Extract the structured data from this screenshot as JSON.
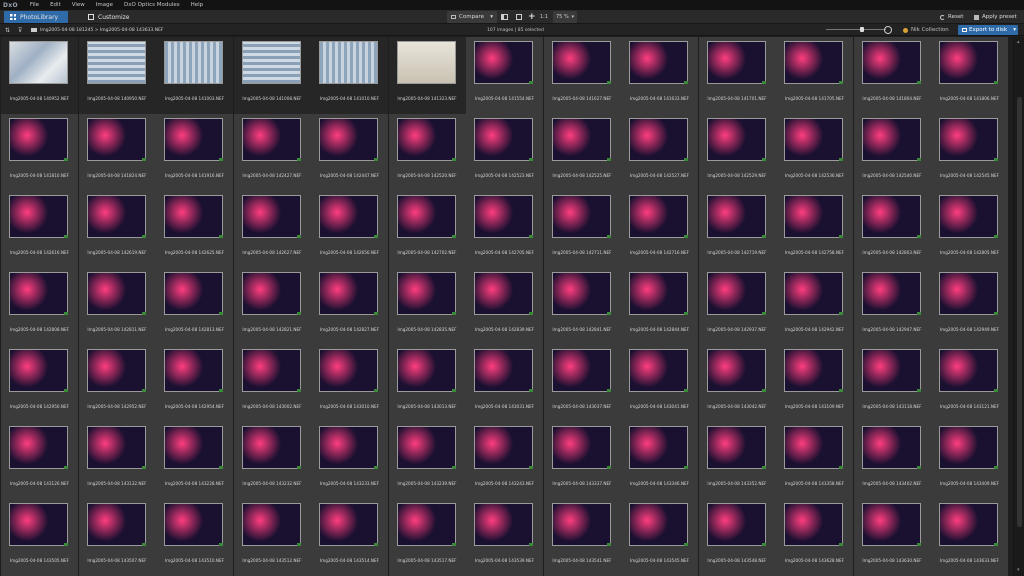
{
  "app": {
    "logo": "DxO"
  },
  "menu": [
    "File",
    "Edit",
    "View",
    "Image",
    "DxO Optics Modules",
    "Help"
  ],
  "tabs": {
    "photolibrary": "PhotoLibrary",
    "customize": "Customize"
  },
  "toolbar": {
    "compare": "Compare",
    "ratio": "1:1",
    "zoom": "75 %",
    "reset": "Reset",
    "apply_preset": "Apply preset"
  },
  "pathbar": {
    "path": "Img2005-04-08 181245 > Img2005-04-08 143633.NEF",
    "count": "107 images | 85 selected",
    "nik": "Nik Collection",
    "export": "Export to disk"
  },
  "colors": {
    "accent": "#2f6ba8",
    "background": "#1e1e1e",
    "cell": "#262626",
    "cell_selected": "#3b3b3b"
  },
  "thumbnails": [
    "Img2005-04-08 140952.NEF",
    "Img2005-04-08 140950.NEF",
    "Img2005-04-08 141003.NEF",
    "Img2005-04-08 141008.NEF",
    "Img2005-04-08 141010.NEF",
    "Img2005-04-08 141323.NEF",
    "Img2005-04-08 141554.NEF",
    "Img2005-04-08 141627.NEF",
    "Img2005-04-08 141633.NEF",
    "Img2005-04-08 141701.NEF",
    "Img2005-04-08 141705.NEF",
    "Img2005-04-08 141804.NEF",
    "Img2005-04-08 141806.NEF",
    "Img2005-04-08 141810.NEF",
    "Img2005-04-08 141824.NEF",
    "Img2005-04-08 141916.NEF",
    "Img2005-04-08 142427.NEF",
    "Img2005-04-08 142447.NEF",
    "Img2005-04-08 142520.NEF",
    "Img2005-04-08 142523.NEF",
    "Img2005-04-08 142525.NEF",
    "Img2005-04-08 142527.NEF",
    "Img2005-04-08 142529.NEF",
    "Img2005-04-08 142536.NEF",
    "Img2005-04-08 142540.NEF",
    "Img2005-04-08 142545.NEF",
    "Img2005-04-08 142616.NEF",
    "Img2005-04-08 142619.NEF",
    "Img2005-04-08 142625.NEF",
    "Img2005-04-08 142627.NEF",
    "Img2005-04-08 142656.NEF",
    "Img2005-04-08 142702.NEF",
    "Img2005-04-08 142705.NEF",
    "Img2005-04-08 142711.NEF",
    "Img2005-04-08 142716.NEF",
    "Img2005-04-08 142719.NEF",
    "Img2005-04-08 142758.NEF",
    "Img2005-04-08 142803.NEF",
    "Img2005-04-08 142805.NEF",
    "Img2005-04-08 142808.NEF",
    "Img2005-04-08 142811.NEF",
    "Img2005-04-08 142813.NEF",
    "Img2005-04-08 142821.NEF",
    "Img2005-04-08 142827.NEF",
    "Img2005-04-08 142835.NEF",
    "Img2005-04-08 142839.NEF",
    "Img2005-04-08 142841.NEF",
    "Img2005-04-08 142844.NEF",
    "Img2005-04-08 142937.NEF",
    "Img2005-04-08 142942.NEF",
    "Img2005-04-08 142947.NEF",
    "Img2005-04-08 142949.NEF",
    "Img2005-04-08 142950.NEF",
    "Img2005-04-08 142952.NEF",
    "Img2005-04-08 142954.NEF",
    "Img2005-04-08 143002.NEF",
    "Img2005-04-08 143010.NEF",
    "Img2005-04-08 143013.NEF",
    "Img2005-04-08 143031.NEF",
    "Img2005-04-08 143037.NEF",
    "Img2005-04-08 143041.NEF",
    "Img2005-04-08 143042.NEF",
    "Img2005-04-08 143109.NEF",
    "Img2005-04-08 143118.NEF",
    "Img2005-04-08 143121.NEF",
    "Img2005-04-08 143126.NEF",
    "Img2005-04-08 143132.NEF",
    "Img2005-04-08 143228.NEF",
    "Img2005-04-08 143232.NEF",
    "Img2005-04-08 143233.NEF",
    "Img2005-04-08 143239.NEF",
    "Img2005-04-08 143243.NEF",
    "Img2005-04-08 143337.NEF",
    "Img2005-04-08 143346.NEF",
    "Img2005-04-08 143352.NEF",
    "Img2005-04-08 143358.NEF",
    "Img2005-04-08 143402.NEF",
    "Img2005-04-08 143409.NEF",
    "Img2005-04-08 143505.NEF",
    "Img2005-04-08 143507.NEF",
    "Img2005-04-08 143510.NEF",
    "Img2005-04-08 143512.NEF",
    "Img2005-04-08 143514.NEF",
    "Img2005-04-08 143517.NEF",
    "Img2005-04-08 143539.NEF",
    "Img2005-04-08 143541.NEF",
    "Img2005-04-08 143545.NEF",
    "Img2005-04-08 143548.NEF",
    "Img2005-04-08 143628.NEF",
    "Img2005-04-08 143630.NEF",
    "Img2005-04-08 143633.NEF"
  ]
}
